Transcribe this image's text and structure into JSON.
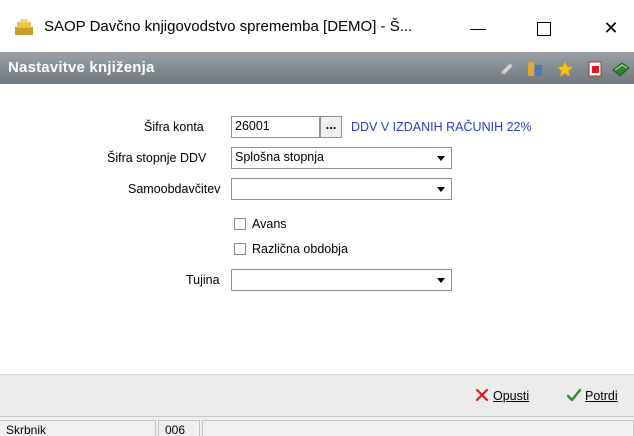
{
  "window": {
    "title": "SAOP  Davčno knjigovodstvo sprememba [DEMO] - Š...",
    "minimize": "—",
    "maximize": "☐",
    "close": "✕"
  },
  "header": {
    "title": "Nastavitve knjiženja",
    "icons": [
      "edit-icon",
      "columns-icon",
      "star-icon",
      "delete-icon",
      "book-icon"
    ]
  },
  "form": {
    "sifra_konta_label": "Šifra konta",
    "sifra_konta_value": "26001",
    "sifra_konta_button": "...",
    "sifra_konta_desc": "DDV V IZDANIH RAČUNIH 22%",
    "stopnja_label": "Šifra stopnje DDV",
    "stopnja_value": "Splošna stopnja",
    "samoobdavcitev_label": "Samoobdavčitev",
    "samoobdavcitev_value": "",
    "avans_label": "Avans",
    "avans_checked": false,
    "razlicna_label": "Različna obdobja",
    "razlicna_checked": false,
    "tujina_label": "Tujina",
    "tujina_value": ""
  },
  "buttons": {
    "cancel": "Opusti",
    "confirm": "Potrdi"
  },
  "status": {
    "user": "Skrbnik",
    "code": "006",
    "info": ""
  },
  "colors": {
    "header_bg": "#7d858c",
    "link_blue": "#2a3fc8",
    "cancel_red": "#d42020",
    "confirm_green": "#2e8b2e"
  }
}
